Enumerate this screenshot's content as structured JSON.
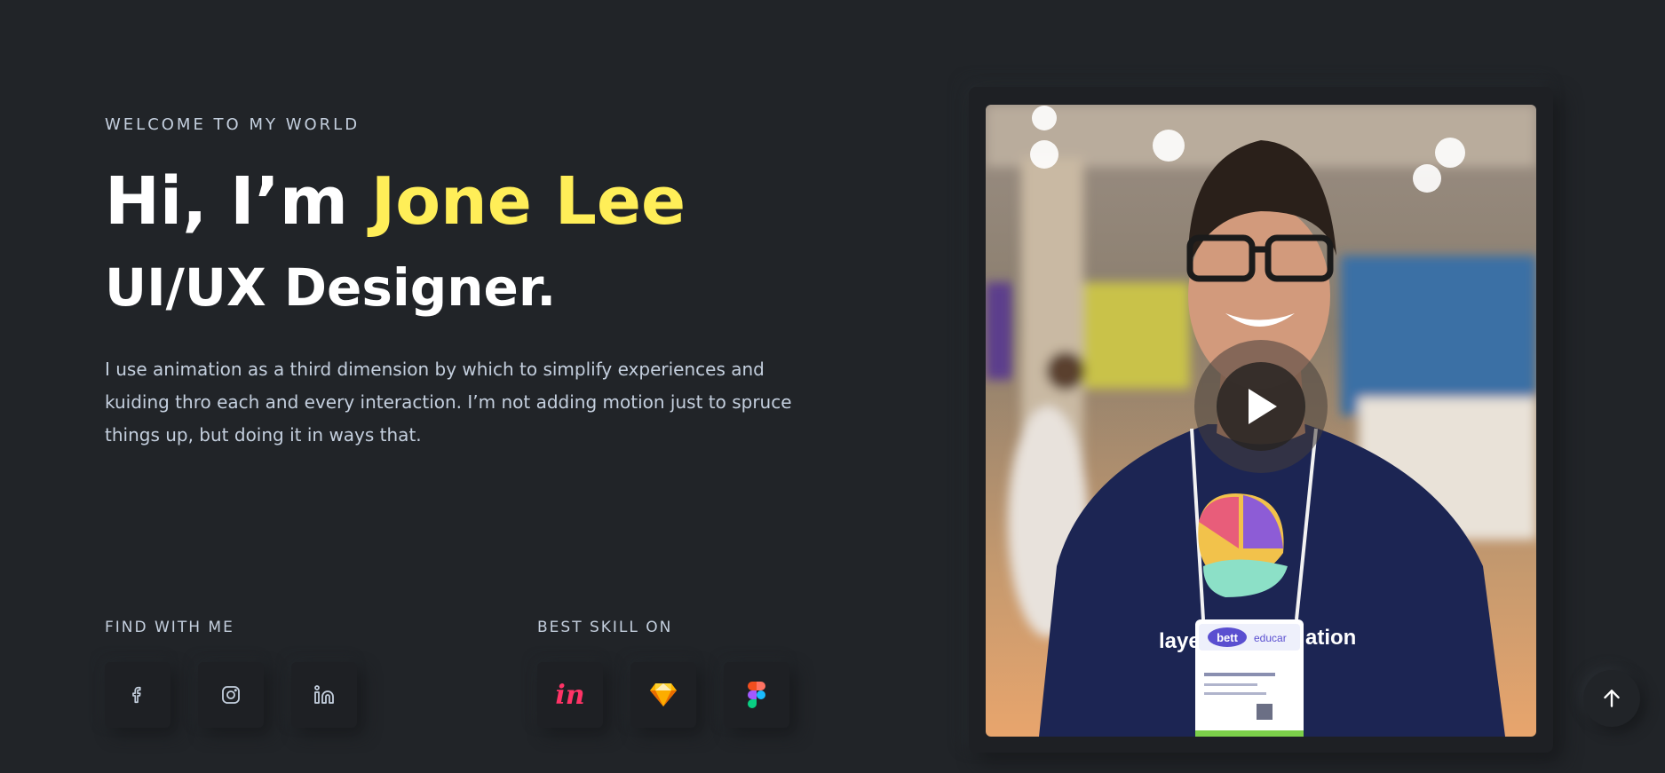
{
  "hero": {
    "welcome": "WELCOME TO MY WORLD",
    "greeting": "Hi, I’m ",
    "name": "Jone Lee",
    "role": "UI/UX Designer.",
    "bio": "I use animation as a third dimension by which to simplify experiences and kuiding thro each and every interaction. I’m not adding motion just to spruce things up, but doing it in ways that."
  },
  "social": {
    "label": "FIND WITH ME",
    "items": [
      {
        "icon": "facebook-icon"
      },
      {
        "icon": "instagram-icon"
      },
      {
        "icon": "linkedin-icon"
      }
    ]
  },
  "skills": {
    "label": "BEST SKILL ON",
    "items": [
      {
        "icon": "invision-icon",
        "text": "in"
      },
      {
        "icon": "sketch-icon"
      },
      {
        "icon": "figma-icon"
      }
    ]
  },
  "photo": {
    "lanyard_badge": "bett",
    "lanyard_text": "educar",
    "shirt_text_left": "laye",
    "shirt_text_right": "ation"
  },
  "colors": {
    "background": "#212428",
    "accent": "#ffee58",
    "text_muted": "#c4cfde"
  }
}
